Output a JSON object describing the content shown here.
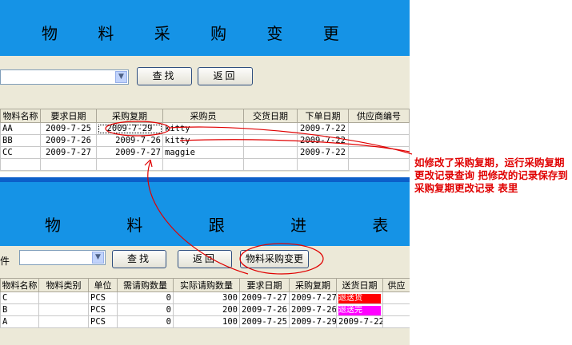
{
  "top": {
    "title": "物 料 采 购 变 更",
    "buttons": {
      "search": "查找",
      "back": "返回"
    },
    "table": {
      "headers": [
        "物料名称",
        "要求日期",
        "采购复期",
        "采购员",
        "交货日期",
        "下单日期",
        "供应商编号"
      ],
      "rows": [
        [
          "AA",
          "2009-7-25",
          "2009-7-29",
          "kitty",
          "",
          "2009-7-22",
          ""
        ],
        [
          "BB",
          "2009-7-26",
          "2009-7-26",
          "kitty",
          "",
          "2009-7-22",
          ""
        ],
        [
          "CC",
          "2009-7-27",
          "2009-7-27",
          "maggie",
          "",
          "2009-7-22",
          ""
        ]
      ]
    }
  },
  "bottom": {
    "title": "物 料 跟 进 表",
    "label": "件",
    "buttons": {
      "search": "查找",
      "back": "返回",
      "change": "物料采购变更"
    },
    "table": {
      "headers": [
        "物料名称",
        "物料类别",
        "单位",
        "需请购数量",
        "实际请购数量",
        "要求日期",
        "采购复期",
        "送货日期",
        "供应"
      ],
      "rows": [
        [
          "C",
          "",
          "PCS",
          "0",
          "300",
          "2009-7-27",
          "2009-7-27",
          "退送货"
        ],
        [
          "B",
          "",
          "PCS",
          "0",
          "200",
          "2009-7-26",
          "2009-7-26",
          "退送完"
        ],
        [
          "A",
          "",
          "PCS",
          "0",
          "100",
          "2009-7-25",
          "2009-7-29",
          "2009-7-22"
        ]
      ]
    }
  },
  "annotation": "如修改了采购复期，运行采购复期更改记录查询 把修改的记录保存到 采购复期更改记录 表里",
  "colors": {
    "banner": "#1593e6",
    "annotation": "#e00000",
    "badge_red": "#ff0000",
    "badge_magenta": "#ff00ff"
  }
}
